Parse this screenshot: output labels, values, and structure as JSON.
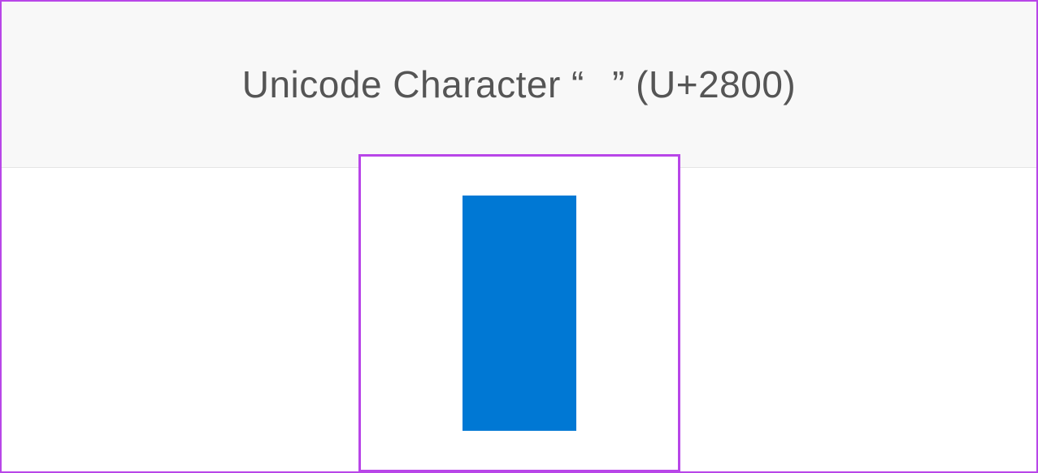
{
  "header": {
    "title_prefix": "Unicode Character “",
    "title_char": "⠀",
    "title_suffix": "” (U+2800)"
  },
  "glyph": {
    "codepoint": "U+2800",
    "display_color": "#0078d4"
  }
}
